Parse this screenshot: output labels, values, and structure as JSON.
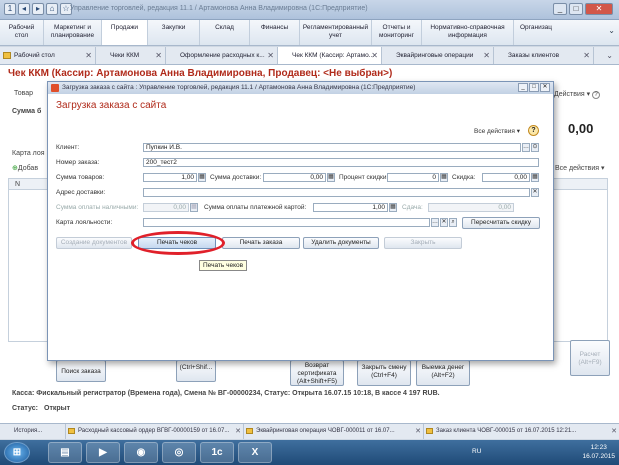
{
  "window": {
    "title": "Управление торговлей, редакция 11.1 / Артамонова Анна Владимировна (1С:Предприятие)"
  },
  "sections": [
    {
      "label": "Рабочий\nстол"
    },
    {
      "label": "Маркетинг и\nпланирование"
    },
    {
      "label": "Продажи"
    },
    {
      "label": "Закупки"
    },
    {
      "label": "Склад"
    },
    {
      "label": "Финансы"
    },
    {
      "label": "Регламентированный\nучет"
    },
    {
      "label": "Отчеты и\nмониторинг"
    },
    {
      "label": "Нормативно-справочная\nинформация"
    },
    {
      "label": "Организац"
    }
  ],
  "tabs": [
    {
      "label": "Рабочий стол"
    },
    {
      "label": "Чеки ККМ"
    },
    {
      "label": "Оформление расходных к..."
    },
    {
      "label": "Чек ККМ (Кассир: Артамо..."
    },
    {
      "label": "Эквайринговые операции"
    },
    {
      "label": "Заказы клиентов"
    }
  ],
  "document": {
    "title": "Чек ККМ (Кассир: Артамонова Анна Владимировна, Продавец: <Не выбран>)",
    "goods_label": "Товар",
    "all_actions": "Действия",
    "sum_label": "Сумма б",
    "total_value": "0,00",
    "card_label": "Карта лоя",
    "add_label": "Добав",
    "col_n": "N",
    "all_actions2": "Все действия",
    "status_line": "Касса: Фискальный регистратор (Времена года), Смена № ВГ-00000234, Статус: Открыта 16.07.15 10:18, В кассе 4 197 RUB.",
    "status_label": "Статус:",
    "status_value": "Открыт",
    "buttons": {
      "search_order": "Поиск заказа",
      "ctrl_shift": "(Ctrl+Shif...",
      "return_cert": "Возврат\nсертификата\n(Alt+Shift+F5)",
      "close_shift": "Закрыть смену\n(Ctrl+F4)",
      "withdraw": "Выемка денег\n(Alt+F2)",
      "payment": "Расчет\n(Alt+F9)"
    }
  },
  "dialog": {
    "window_title": "Загрузка заказа с сайта : Управление торговлей, редакция 11.1 / Артамонова Анна Владимировна (1С:Предприятие)",
    "heading": "Загрузка заказа с сайта",
    "all_actions": "Все действия",
    "help": "?",
    "client_label": "Клиент:",
    "client_value": "Пупкин И.В.",
    "order_num_label": "Номер заказа:",
    "order_num_value": "200_тест2",
    "goods_sum_label": "Сумма товаров:",
    "goods_sum_value": "1,00",
    "delivery_sum_label": "Сумма доставки:",
    "delivery_sum_value": "0,00",
    "discount_pct_label": "Процент скидки:",
    "discount_pct_value": "0",
    "discount_label": "Скидка:",
    "discount_value": "0,00",
    "address_label": "Адрес доставки:",
    "address_value": "",
    "cash_paid_label": "Сумма оплаты наличными:",
    "cash_paid_value": "0,00",
    "card_paid_label": "Сумма оплаты платежной картой:",
    "card_paid_value": "1,00",
    "change_label": "Сдача:",
    "change_value": "0,00",
    "loyalty_label": "Карта лояльности:",
    "loyalty_value": "",
    "recalc_discount": "Пересчитать скидку",
    "btn_create_docs": "Создание документов",
    "btn_print_receipts": "Печать чеков",
    "btn_print_order": "Печать заказа",
    "btn_delete_docs": "Удалить документы",
    "btn_close": "Закрыть",
    "tooltip": "Печать чеков"
  },
  "window_panel": [
    {
      "label": "История..."
    },
    {
      "label": "Расходный кассовый ордер ВГВГ-00000159 от 16.07..."
    },
    {
      "label": "Эквайринговая операция ЧОВГ-000011 от 16.07..."
    },
    {
      "label": "Заказ клиента ЧОВГ-000015 от 16.07.2015 12:21..."
    }
  ],
  "taskbar": {
    "lang": "RU",
    "time": "12:23",
    "date": "16.07.2015"
  }
}
